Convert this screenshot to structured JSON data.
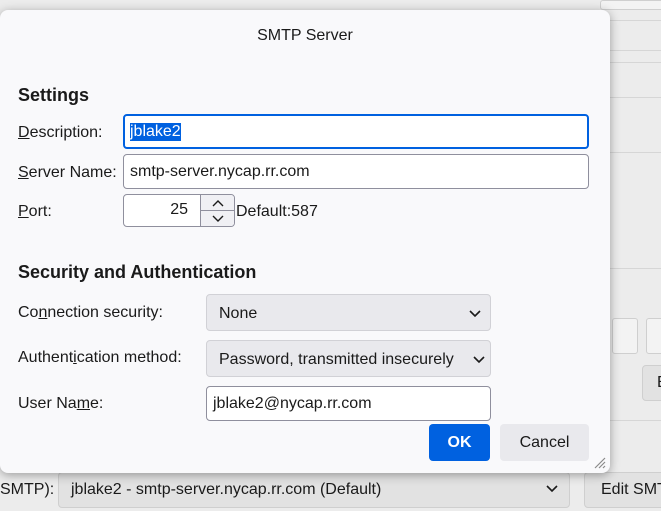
{
  "dialog": {
    "title": "SMTP Server",
    "settings": {
      "heading": "Settings",
      "description": {
        "label_pre": "",
        "label_ul": "D",
        "label_post": "escription:",
        "value": "jblake2"
      },
      "server_name": {
        "label_pre": "",
        "label_ul": "S",
        "label_post": "erver Name:",
        "value": "smtp-server.nycap.rr.com"
      },
      "port": {
        "label_pre": "",
        "label_ul": "P",
        "label_post": "ort:",
        "value": "25",
        "default_text": "Default:587"
      }
    },
    "security": {
      "heading": "Security and Authentication",
      "connection_security": {
        "label_pre": "Co",
        "label_ul": "n",
        "label_post": "nection security:",
        "value": "None"
      },
      "auth_method": {
        "label_pre": "Authent",
        "label_ul": "i",
        "label_post": "cation method:",
        "value": "Password, transmitted insecurely"
      },
      "user_name": {
        "label_pre": "User Na",
        "label_ul": "m",
        "label_post": "e:",
        "value": "jblake2@nycap.rr.com"
      }
    },
    "buttons": {
      "ok": "OK",
      "cancel": "Cancel"
    }
  },
  "background": {
    "outgoing_label": "SMTP):",
    "outgoing_value": "jblake2 - smtp-server.nycap.rr.com (Default)",
    "edit_button": "Edit SMTP",
    "e_button": "E"
  },
  "colors": {
    "accent": "#0061e0",
    "dialog_bg": "#f9f9fb"
  }
}
